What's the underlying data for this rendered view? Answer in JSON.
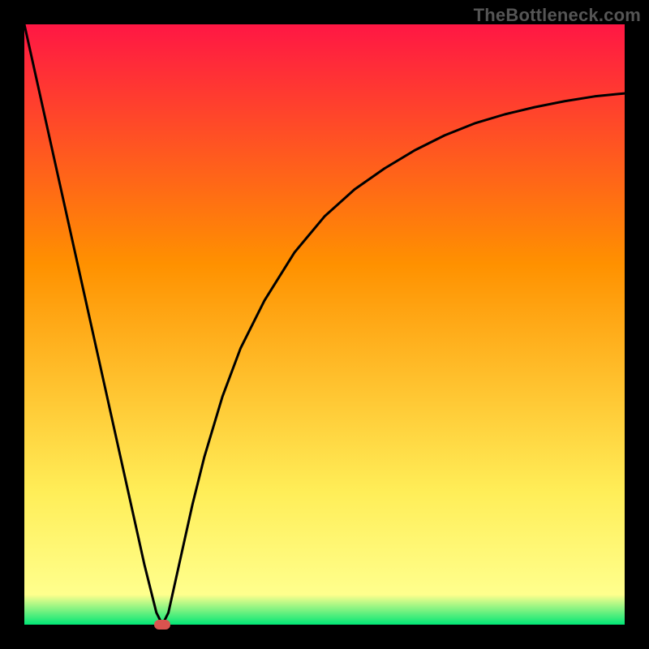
{
  "watermark": {
    "text": "TheBottleneck.com"
  },
  "chart_data": {
    "type": "line",
    "title": "",
    "xlabel": "",
    "ylabel": "",
    "xlim": [
      0,
      100
    ],
    "ylim": [
      0,
      100
    ],
    "background_gradient": {
      "top_color": "#ff1744",
      "mid_color_1": "#ff9100",
      "mid_color_2": "#ffee58",
      "bottom_color": "#00e676"
    },
    "axis_visible": false,
    "grid": false,
    "series": [
      {
        "name": "bottleneck-curve",
        "x": [
          0,
          2,
          4,
          6,
          8,
          10,
          12,
          14,
          16,
          18,
          20,
          22,
          23,
          24,
          26,
          28,
          30,
          33,
          36,
          40,
          45,
          50,
          55,
          60,
          65,
          70,
          75,
          80,
          85,
          90,
          95,
          100
        ],
        "y": [
          100,
          91,
          82,
          73,
          64,
          55,
          46,
          37,
          28,
          19,
          10,
          2,
          0,
          2,
          11,
          20,
          28,
          38,
          46,
          54,
          62,
          68,
          72.5,
          76,
          79,
          81.5,
          83.5,
          85,
          86.2,
          87.2,
          88,
          88.5
        ]
      }
    ],
    "marker": {
      "x": 23,
      "y": 0,
      "color": "#d9534f"
    }
  }
}
